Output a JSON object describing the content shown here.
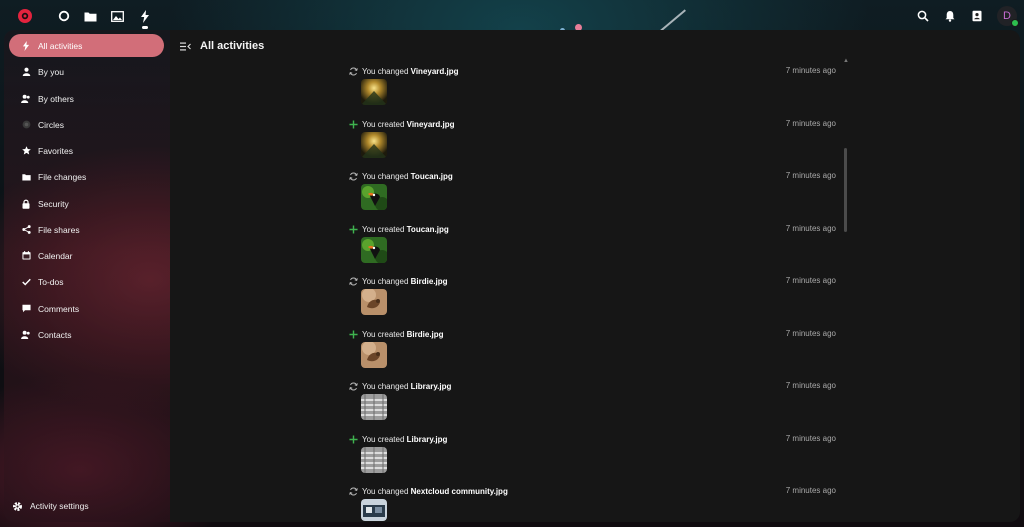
{
  "header": {
    "apps": [
      {
        "name": "dashboard-icon"
      },
      {
        "name": "files-icon"
      },
      {
        "name": "photos-icon"
      },
      {
        "name": "activity-icon",
        "active": true
      }
    ],
    "right": [
      {
        "name": "search-icon"
      },
      {
        "name": "notifications-icon"
      },
      {
        "name": "contacts-icon"
      }
    ],
    "avatar_initial": "D"
  },
  "sidebar": {
    "items": [
      {
        "label": "All activities",
        "icon": "lightning-icon",
        "active": true
      },
      {
        "label": "By you",
        "icon": "person-icon"
      },
      {
        "label": "By others",
        "icon": "people-icon"
      },
      {
        "label": "Circles",
        "icon": "circles-icon"
      },
      {
        "label": "Favorites",
        "icon": "star-icon"
      },
      {
        "label": "File changes",
        "icon": "folder-icon"
      },
      {
        "label": "Security",
        "icon": "lock-icon"
      },
      {
        "label": "File shares",
        "icon": "share-icon"
      },
      {
        "label": "Calendar",
        "icon": "calendar-icon"
      },
      {
        "label": "To-dos",
        "icon": "check-icon"
      },
      {
        "label": "Comments",
        "icon": "comment-icon"
      },
      {
        "label": "Contacts",
        "icon": "contacts-icon"
      }
    ],
    "settings_label": "Activity settings"
  },
  "main": {
    "title": "All activities",
    "activities": [
      {
        "type": "changed",
        "prefix": "You changed ",
        "file": "Vineyard.jpg",
        "time": "7 minutes ago",
        "thumb": "vineyard"
      },
      {
        "type": "created",
        "prefix": "You created ",
        "file": "Vineyard.jpg",
        "time": "7 minutes ago",
        "thumb": "vineyard"
      },
      {
        "type": "changed",
        "prefix": "You changed ",
        "file": "Toucan.jpg",
        "time": "7 minutes ago",
        "thumb": "toucan"
      },
      {
        "type": "created",
        "prefix": "You created ",
        "file": "Toucan.jpg",
        "time": "7 minutes ago",
        "thumb": "toucan"
      },
      {
        "type": "changed",
        "prefix": "You changed ",
        "file": "Birdie.jpg",
        "time": "7 minutes ago",
        "thumb": "birdie"
      },
      {
        "type": "created",
        "prefix": "You created ",
        "file": "Birdie.jpg",
        "time": "7 minutes ago",
        "thumb": "birdie"
      },
      {
        "type": "changed",
        "prefix": "You changed ",
        "file": "Library.jpg",
        "time": "7 minutes ago",
        "thumb": "library"
      },
      {
        "type": "created",
        "prefix": "You created ",
        "file": "Library.jpg",
        "time": "7 minutes ago",
        "thumb": "library"
      },
      {
        "type": "changed",
        "prefix": "You changed ",
        "file": "Nextcloud community.jpg",
        "time": "7 minutes ago",
        "thumb": "community"
      }
    ]
  },
  "colors": {
    "accent": "#d26e79",
    "created": "#3fb34f",
    "panel": "#161616"
  }
}
